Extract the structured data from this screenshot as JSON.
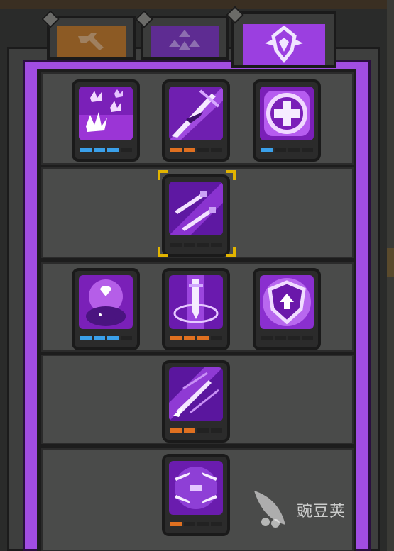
{
  "tabs": [
    {
      "icon": "wrench-icon",
      "color": "#8c5a24",
      "active": false
    },
    {
      "icon": "triangle-gems-icon",
      "color": "#5e2c92",
      "active": false
    },
    {
      "icon": "shield-emblem-icon",
      "color": "#9b3fe0",
      "active": true
    }
  ],
  "skills": [
    {
      "id": "spike-burst",
      "icon": "spike-burst-icon",
      "pips": [
        "blue",
        "blue",
        "blue",
        "dark"
      ]
    },
    {
      "id": "slash-strike",
      "icon": "slash-strike-icon",
      "pips": [
        "orange",
        "orange",
        "dark",
        "dark"
      ]
    },
    {
      "id": "heal-cross",
      "icon": "heal-cross-icon",
      "pips": [
        "blue",
        "dark",
        "dark",
        "dark"
      ]
    },
    {
      "id": "twin-swords",
      "icon": "twin-swords-icon",
      "pips": [
        "dark",
        "dark",
        "dark",
        "dark"
      ],
      "selected": true
    },
    {
      "id": "pet-heal",
      "icon": "pet-heal-icon",
      "pips": [
        "blue",
        "blue",
        "blue",
        "dark"
      ]
    },
    {
      "id": "sword-pillar",
      "icon": "sword-pillar-icon",
      "pips": [
        "orange",
        "orange",
        "orange",
        "dark"
      ]
    },
    {
      "id": "shield-up",
      "icon": "shield-up-icon",
      "pips": [
        "dark",
        "dark",
        "dark",
        "dark"
      ]
    },
    {
      "id": "spear-dash",
      "icon": "spear-dash-icon",
      "pips": [
        "orange",
        "orange",
        "dark",
        "dark"
      ]
    },
    {
      "id": "blade-storm",
      "icon": "blade-storm-icon",
      "pips": [
        "orange",
        "dark",
        "dark",
        "dark"
      ]
    }
  ],
  "colors": {
    "blue": "#3aa0ea",
    "orange": "#e07020",
    "dark": "#222222",
    "accent": "#a14de2"
  },
  "watermark": {
    "text": "豌豆荚"
  }
}
